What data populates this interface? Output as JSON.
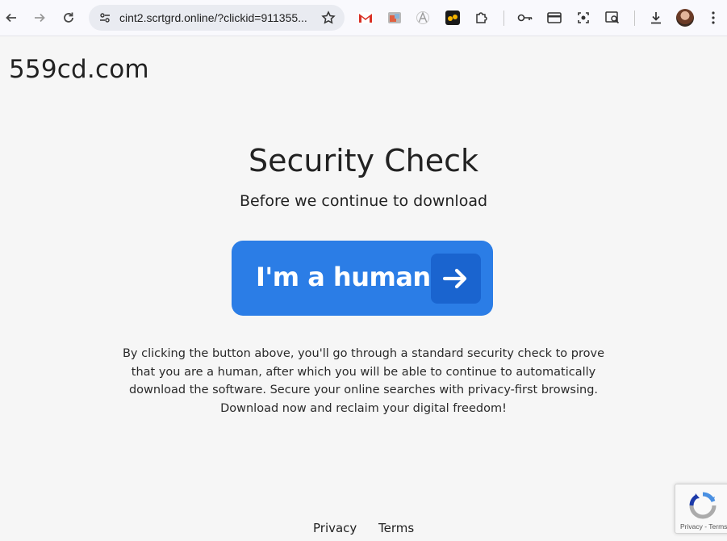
{
  "browser": {
    "url": "cint2.scrtgrd.online/?clickid=911355...",
    "icons": [
      "back-icon",
      "forward-icon",
      "reload-icon",
      "site-settings-icon",
      "bookmark-star-icon",
      "gmail-extension-icon",
      "extension-icon",
      "ai-extension-icon",
      "yellow-extension-icon",
      "extensions-puzzle-icon",
      "password-key-icon",
      "payment-card-icon",
      "screenshot-icon",
      "page-search-icon",
      "downloads-icon",
      "profile-avatar",
      "menu-icon"
    ]
  },
  "page": {
    "site_name": "559cd.com",
    "title": "Security Check",
    "subtitle": "Before we continue to download",
    "button_label": "I'm a human",
    "description": "By clicking the button above, you'll go through a standard security check to prove that you are a human, after which you will be able to continue to automatically download the software. Secure your online searches with privacy-first browsing. Download now and reclaim your digital freedom!"
  },
  "footer": {
    "privacy": "Privacy",
    "terms": "Terms"
  },
  "recaptcha": {
    "links": "Privacy - Terms"
  },
  "colors": {
    "button": "#2b7de6",
    "button_arrow_box": "#1a64cf",
    "background": "#f6f6f6"
  }
}
